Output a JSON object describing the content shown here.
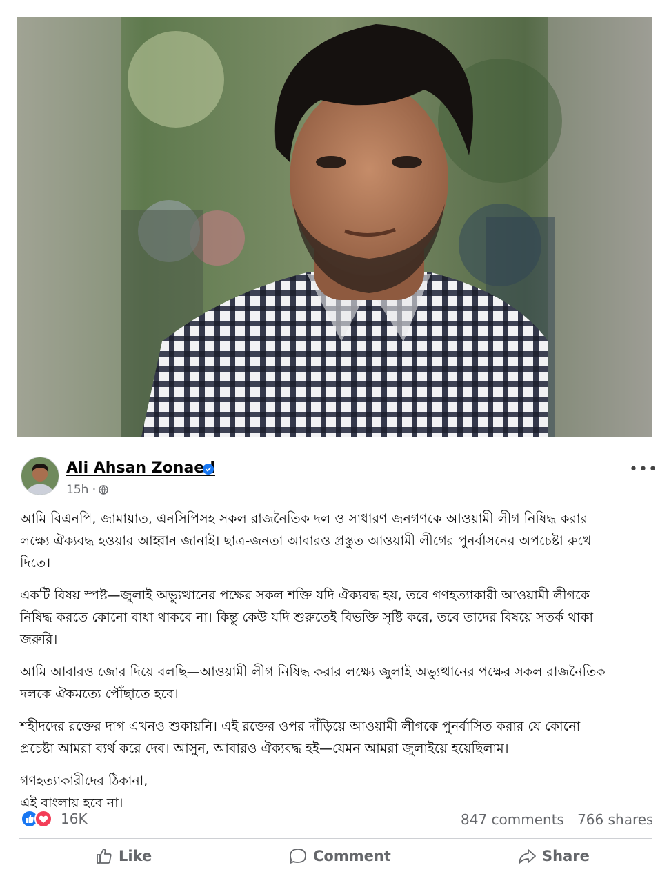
{
  "post": {
    "author": "Ali Ahsan Zonaed",
    "timestamp": "15h ·",
    "paragraphs": [
      [
        "আমি বিএনপি, জামায়াত, এনসিপিসহ সকল রাজনৈতিক দল ও সাধারণ জনগণকে আওয়ামী লীগ নিষিদ্ধ করার",
        "লক্ষ্যে ঐক্যবদ্ধ হওয়ার আহ্বান জানাই। ছাত্র-জনতা আবারও প্রস্তুত আওয়ামী লীগের পুনর্বাসনের অপচেষ্টা রুখে",
        "দিতে।"
      ],
      [
        "একটি বিষয় স্পষ্ট—জুলাই অভ্যুত্থানের পক্ষের সকল শক্তি যদি ঐক্যবদ্ধ হয়, তবে গণহত্যাকারী আওয়ামী লীগকে",
        "নিষিদ্ধ করতে কোনো বাধা থাকবে না। কিন্তু কেউ যদি শুরুতেই বিভক্তি সৃষ্টি করে, তবে তাদের বিষয়ে সতর্ক থাকা",
        "জরুরি।"
      ],
      [
        "আমি আবারও জোর দিয়ে বলছি—আওয়ামী লীগ নিষিদ্ধ করার লক্ষ্যে জুলাই অভ্যুত্থানের পক্ষের সকল রাজনৈতিক",
        "দলকে ঐকমত্যে পৌঁছাতে হবে।"
      ],
      [
        "শহীদদের রক্তের দাগ এখনও শুকায়নি। এই রক্তের ওপর দাঁড়িয়ে আওয়ামী লীগকে পুনর্বাসিত করার যে কোনো",
        "প্রচেষ্টা আমরা ব্যর্থ করে দেব। আসুন, আবারও ঐক্যবদ্ধ হই—যেমন আমরা জুলাইয়ে হয়েছিলাম।"
      ],
      [
        "গণহত্যাকারীদের ঠিকানা,",
        "এই বাংলায় হবে না।"
      ]
    ],
    "reaction_count": "16K",
    "comments": "847 comments",
    "shares": "766 shares",
    "actions": {
      "like": "Like",
      "comment": "Comment",
      "share": "Share"
    }
  },
  "icons": [
    "verified-badge-icon",
    "globe-icon",
    "more-options-icon",
    "like-reaction-icon",
    "love-reaction-icon",
    "thumbs-up-icon",
    "comment-bubble-icon",
    "share-arrow-icon"
  ],
  "colors": {
    "facebook_blue": "#1877f2",
    "love_red": "#f33e58",
    "secondary_text": "#65676b"
  }
}
